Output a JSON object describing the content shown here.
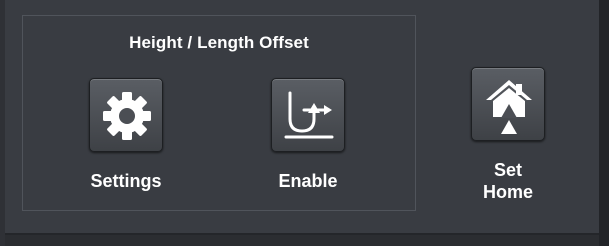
{
  "offset_group": {
    "title": "Height / Length Offset"
  },
  "buttons": {
    "settings": {
      "label": "Settings",
      "icon": "gear-icon"
    },
    "enable": {
      "label": "Enable",
      "icon": "offset-curve-icon"
    },
    "set_home": {
      "label_line1": "Set",
      "label_line2": "Home",
      "icon": "home-icon"
    }
  },
  "colors": {
    "panel": "#393c42",
    "background": "#2b2d31",
    "text": "#ffffff",
    "icon": "#ffffff"
  }
}
